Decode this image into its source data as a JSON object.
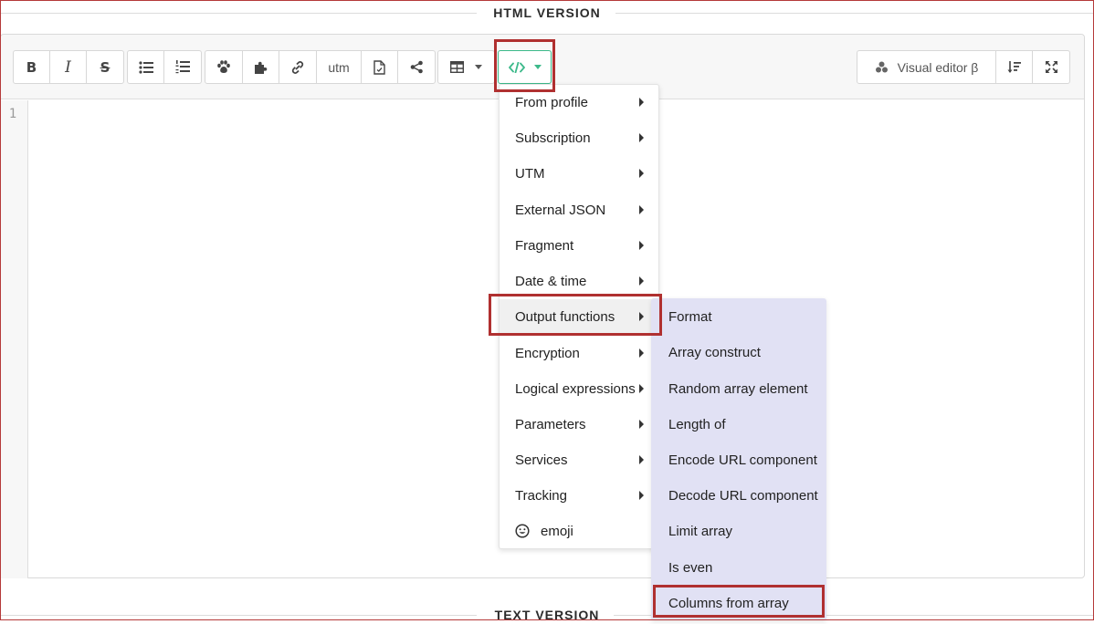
{
  "sections": {
    "html_version": "HTML VERSION",
    "text_version": "TEXT VERSION"
  },
  "toolbar": {
    "formatting": [
      {
        "name": "bold-icon",
        "glyph": "B"
      },
      {
        "name": "italic-icon",
        "glyph": "I"
      },
      {
        "name": "strikethrough-icon",
        "glyph": "S"
      }
    ],
    "utm_label": "utm",
    "visual_editor_label": "Visual editor β",
    "accent_color": "#3cb98a"
  },
  "editor": {
    "line_number": "1"
  },
  "menu": {
    "items": [
      {
        "label": "From profile"
      },
      {
        "label": "Subscription"
      },
      {
        "label": "UTM"
      },
      {
        "label": "External JSON"
      },
      {
        "label": "Fragment"
      },
      {
        "label": "Date & time"
      },
      {
        "label": "Output functions"
      },
      {
        "label": "Encryption"
      },
      {
        "label": "Logical expressions"
      },
      {
        "label": "Parameters"
      },
      {
        "label": "Services"
      },
      {
        "label": "Tracking"
      }
    ],
    "emoji_label": "emoji"
  },
  "submenu": {
    "items": [
      {
        "label": "Format"
      },
      {
        "label": "Array construct"
      },
      {
        "label": "Random array element"
      },
      {
        "label": "Length of"
      },
      {
        "label": "Encode URL component"
      },
      {
        "label": "Decode URL component"
      },
      {
        "label": "Limit array"
      },
      {
        "label": "Is even"
      },
      {
        "label": "Columns from array"
      }
    ],
    "background_color": "#e1e1f4"
  },
  "highlight_color": "#b03030"
}
